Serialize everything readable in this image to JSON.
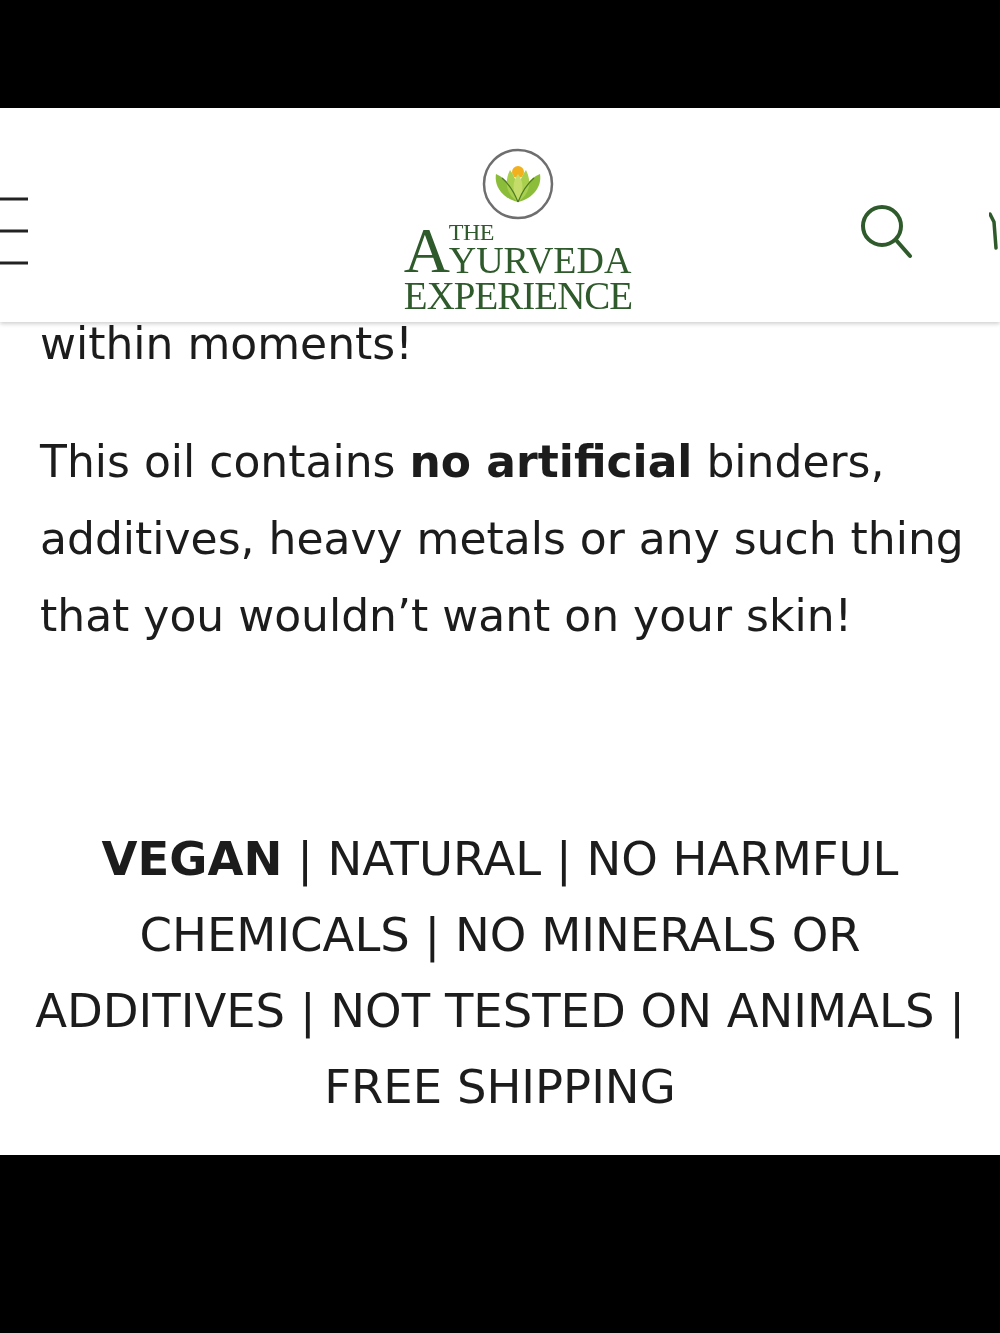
{
  "header": {
    "logo": {
      "initial": "A",
      "top_word": "THE",
      "name": "YURVEDA",
      "subtitle": "EXPERIENCE"
    }
  },
  "content": {
    "paragraphs": [
      "within moments!",
      "This oil contains **no artificial** binders, additives, heavy metals or any such thing that you wouldn’t want on your skin!"
    ],
    "tagline": "**VEGAN** | NATURAL | NO HARMFUL CHEMICALS | NO MINERALS OR ADDITIVES | NOT TESTED ON ANIMALS | FREE SHIPPING"
  }
}
